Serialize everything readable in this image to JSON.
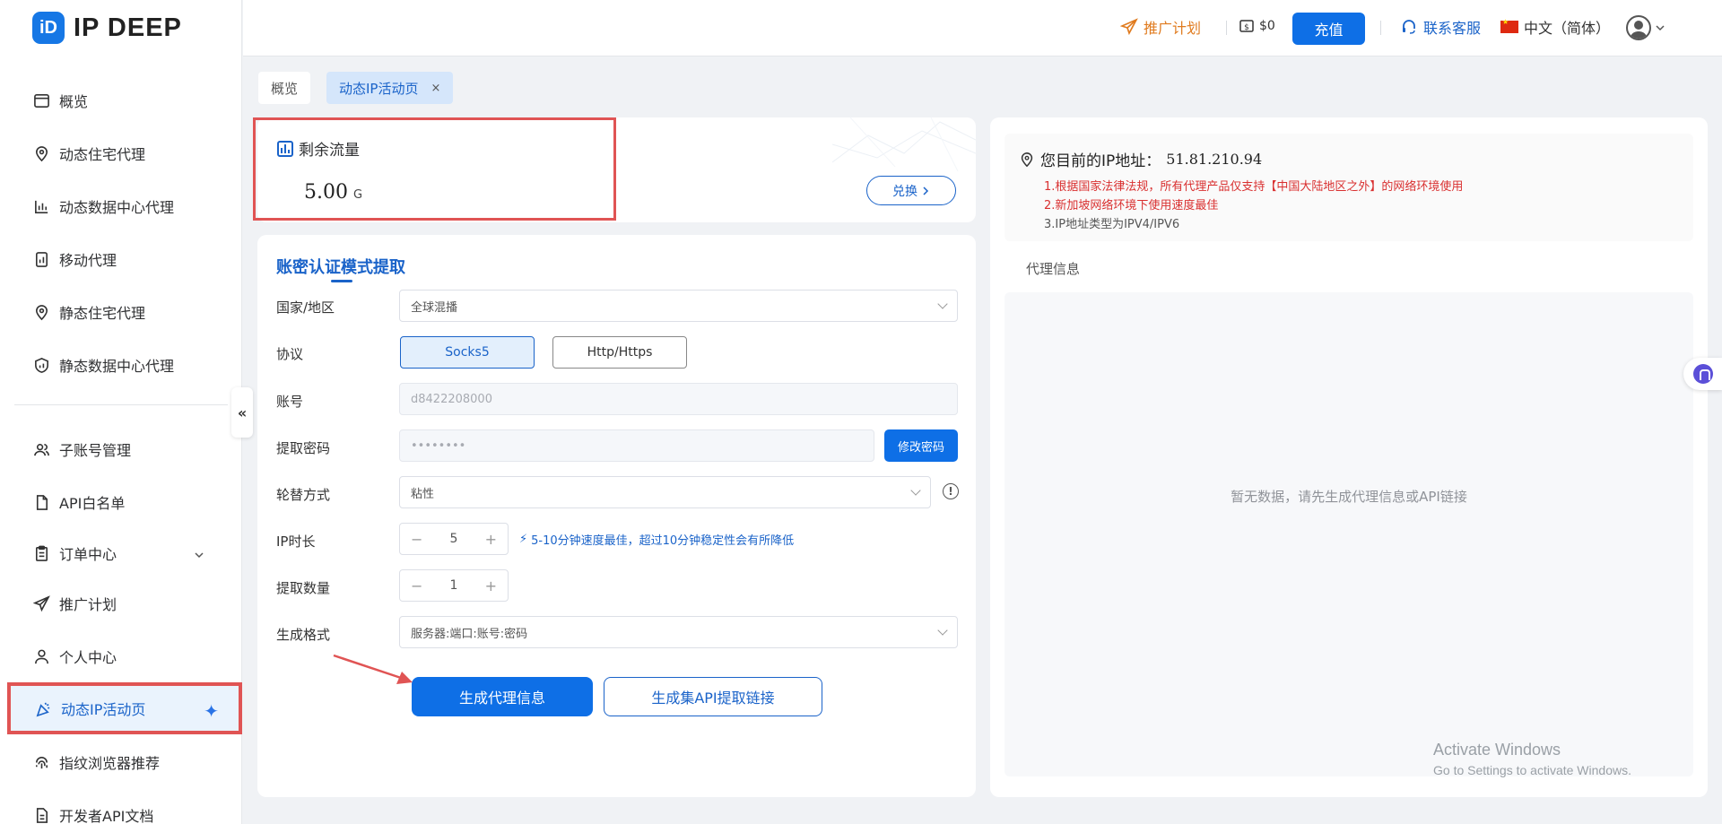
{
  "brand": {
    "logo_mark": "iD",
    "name": "IP DEEP"
  },
  "sidebar": {
    "items": [
      {
        "label": "概览",
        "icon": "window-icon"
      },
      {
        "label": "动态住宅代理",
        "icon": "location-pin-icon"
      },
      {
        "label": "动态数据中心代理",
        "icon": "bar-chart-icon"
      },
      {
        "label": "移动代理",
        "icon": "mobile-chart-icon"
      },
      {
        "label": "静态住宅代理",
        "icon": "location-pin-icon"
      },
      {
        "label": "静态数据中心代理",
        "icon": "shield-chart-icon"
      },
      {
        "label": "子账号管理",
        "icon": "users-icon"
      },
      {
        "label": "API白名单",
        "icon": "document-icon"
      },
      {
        "label": "订单中心",
        "icon": "clipboard-icon"
      },
      {
        "label": "推广计划",
        "icon": "send-icon"
      },
      {
        "label": "个人中心",
        "icon": "user-icon"
      },
      {
        "label": "动态IP活动页",
        "icon": "party-icon"
      },
      {
        "label": "指纹浏览器推荐",
        "icon": "fingerprint-icon"
      },
      {
        "label": "开发者API文档",
        "icon": "doc-icon"
      }
    ],
    "collapse_label": "«"
  },
  "header": {
    "promo_label": "推广计划",
    "balance": "$0",
    "recharge_label": "充值",
    "service_label": "联系客服",
    "language": "中文（简体）"
  },
  "tabs": [
    {
      "label": "概览"
    },
    {
      "label": "动态IP活动页",
      "close": "×"
    }
  ],
  "traffic": {
    "title": "剩余流量",
    "value": "5.00",
    "unit": "G",
    "exchange_label": "兑换"
  },
  "form": {
    "title": "账密认证模式提取",
    "country_label": "国家/地区",
    "country_value": "全球混播",
    "protocol_label": "协议",
    "protocol_options": [
      "Socks5",
      "Http/Https"
    ],
    "account_label": "账号",
    "account_value": "d8422208000",
    "password_label": "提取密码",
    "password_value": "••••••••",
    "change_password_label": "修改密码",
    "rotation_label": "轮替方式",
    "rotation_value": "粘性",
    "duration_label": "IP时长",
    "duration_value": "5",
    "duration_hint": "5-10分钟速度最佳，超过10分钟稳定性会有所降低",
    "quantity_label": "提取数量",
    "quantity_value": "1",
    "format_label": "生成格式",
    "format_value": "服务器:端口:账号:密码",
    "generate_label": "生成代理信息",
    "api_label": "生成集API提取链接"
  },
  "ip_panel": {
    "ip_title": "您目前的IP地址：",
    "ip_address": "51.81.210.94",
    "notes": [
      "1.根据国家法律法规，所有代理产品仅支持【中国大陆地区之外】的网络环境使用",
      "2.新加坡网络环境下使用速度最佳",
      "3.IP地址类型为IPV4/IPV6"
    ],
    "proxy_info_label": "代理信息",
    "empty_text": "暂无数据，请先生成代理信息或API链接"
  },
  "watermark": {
    "line1": "Activate Windows",
    "line2": "Go to Settings to activate Windows."
  },
  "colors": {
    "primary": "#0e6fe6",
    "highlight": "#e05454",
    "promo": "#e07b1f"
  }
}
